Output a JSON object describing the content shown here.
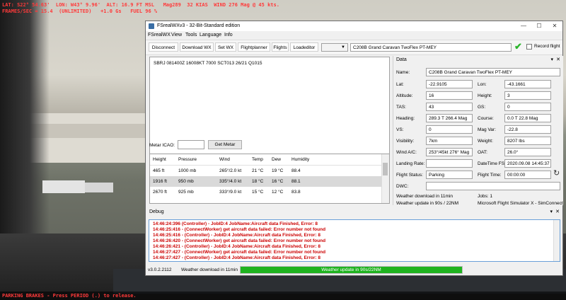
{
  "hud": {
    "line1": "LAT: S22° 54.63'  LON: W43° 9.96'  ALT: 16.9 FT MSL   Mag289  32 KIAS  WIND 276 Mag @ 45 kts.",
    "line2": "FRAMES/SEC = 15.4  (UNLIMITED)   +1.0 Gs   FUEL 96 %",
    "bottom": "PARKING BRAKES - Press PERIOD (.) to release."
  },
  "window": {
    "title": "FSrealWXv3 - 32-Bit-Standard edition",
    "menu": [
      "FSrealWX",
      "View",
      "Tools",
      "Language",
      "Info"
    ],
    "toolbar": {
      "buttons": [
        "Disconnect",
        "Download WX",
        "Set WX",
        "Flightplanner",
        "Flights",
        "Loadeditor"
      ],
      "aircraft": "C208B Grand Caravan TwoFlex PT-MEY",
      "record_label": "Record flight"
    }
  },
  "metar": {
    "text": "SBRJ 081400Z 16008KT 7000 SCT013 26/21 Q1015",
    "icao_label": "Metar ICAO:",
    "icao_value": "",
    "get_button": "Get Metar"
  },
  "wx_table": {
    "headers": [
      "Height",
      "Pressure",
      "Wind",
      "Temp",
      "Dew",
      "Humidity"
    ],
    "rows": [
      [
        "465 ft",
        "1000 mb",
        "265°/2.0 kt",
        "21 °C",
        "19 °C",
        "88.4"
      ],
      [
        "1916 ft",
        "950 mb",
        "335°/4.0 kt",
        "18 °C",
        "16 °C",
        "88.1"
      ],
      [
        "2670 ft",
        "925 mb",
        "333°/9.0 kt",
        "15 °C",
        "12 °C",
        "83.8"
      ]
    ],
    "selected_row": 1
  },
  "data_panel": {
    "header": "Data",
    "name_label": "Name:",
    "name_value": "C208B Grand Caravan TwoFlex PT-MEY",
    "lat_label": "Lat:",
    "lat_value": "-22.9105",
    "lon_label": "Lon:",
    "lon_value": "-43.1661",
    "alt_label": "Altitude:",
    "alt_value": "16",
    "height_label": "Height:",
    "height_value": "3",
    "tas_label": "TAS:",
    "tas_value": "43",
    "gs_label": "GS:",
    "gs_value": "0",
    "heading_label": "Heading:",
    "heading_value": "289.3 T 266.4 Mag",
    "course_label": "Course:",
    "course_value": "0.0 T 22.8 Mag",
    "vs_label": "VS:",
    "vs_value": "0",
    "magvar_label": "Mag Var:",
    "magvar_value": "-22.8",
    "vis_label": "Visibility:",
    "vis_value": "7km",
    "weight_label": "Weight:",
    "weight_value": "8207 lbs",
    "wind_label": "Wind A/C:",
    "wind_value": "253°/45kt 276° Mag",
    "oat_label": "OAT:",
    "oat_value": "26.0°",
    "landing_label": "Landing Rate:",
    "landing_value": "",
    "datetime_label": "DateTime FS:",
    "datetime_value": "2020.09.08 14:45:37",
    "status_label": "Flight Status:",
    "status_value": "Parking",
    "ftime_label": "Flight Time:",
    "ftime_value": "00:00:00",
    "dwc_label": "DWC:",
    "dwc_value": "",
    "wx_download": "Weather download in 11min",
    "jobs": "Jobs: 1",
    "wx_update": "Weather update in 90s / 22NM",
    "connection": "Microsoft Flight Simulator X - SimConnect"
  },
  "debug": {
    "header": "Debug",
    "lines": [
      "14:46:24:396   (Controller) - JobID:4 JobName:Aircraft data Finished, Error: 8",
      "14:46:25:416 - (ConnectWorker) get aircraft data failed: Error number not found",
      "14:46:25:416 - (Controller) - JobID:4 JobName:Aircraft data Finished, Error: 8",
      "14:46:26:420 - (ConnectWorker) get aircraft data failed: Error number not found",
      "14:46:26:421 - (Controller) - JobID:4 JobName:Aircraft data Finished, Error: 8",
      "14:46:27:427 - (ConnectWorker) get aircraft data failed: Error number not found",
      "14:46:27:427 - (Controller) - JobID:4 JobName:Aircraft data Finished, Error: 8"
    ]
  },
  "status": {
    "version": "v3.0.2.2112",
    "download": "Weather download in 11min",
    "progress_text": "Weather update in 90s/22NM",
    "progress_fraction": 1.0
  },
  "colors": {
    "error_text": "#cc0000",
    "progress": "#1fb31f",
    "hud": "#ff3a3a",
    "check": "#2cb52c"
  }
}
